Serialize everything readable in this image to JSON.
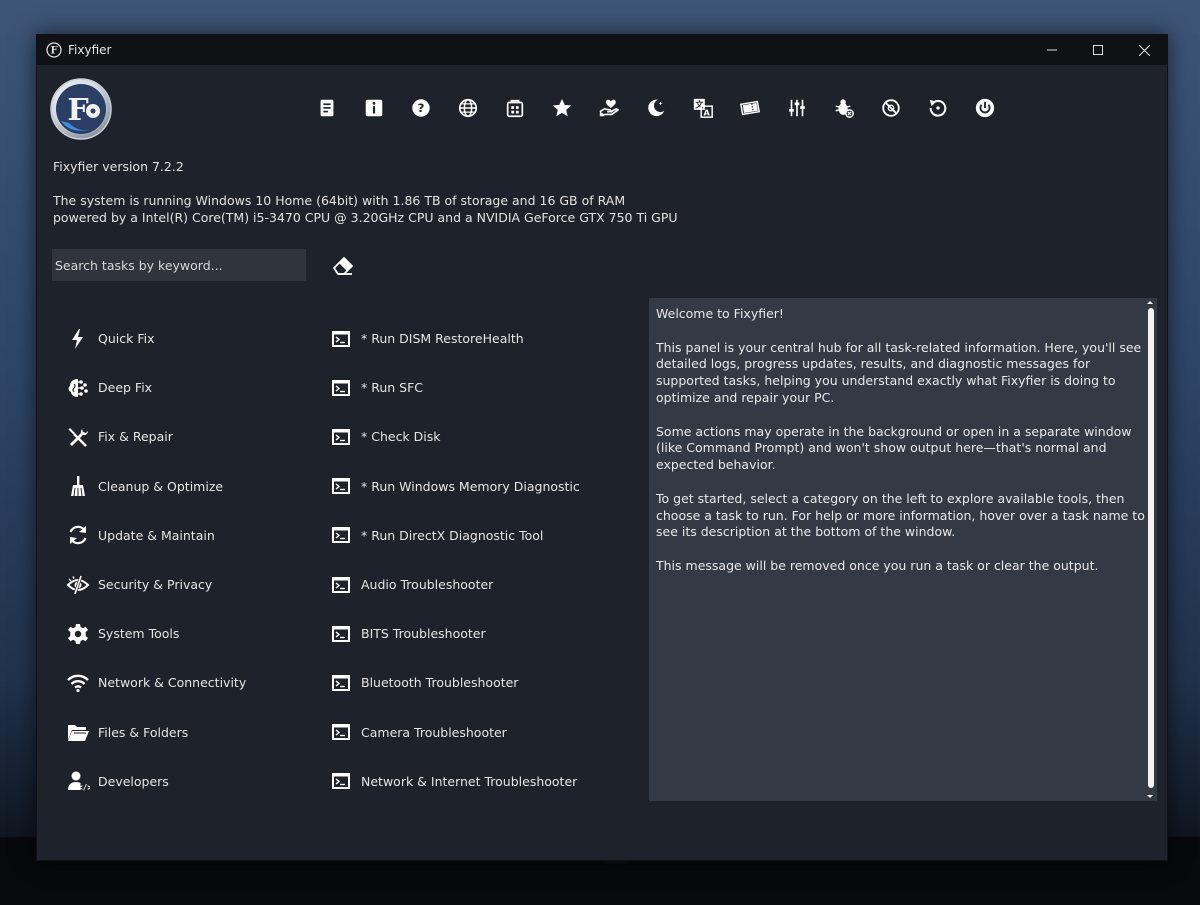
{
  "window": {
    "title": "Fixyfier",
    "version_label": "Fixyfier version 7.2.2",
    "sysinfo_line1": "The system is running Windows 10 Home (64bit) with 1.86 TB of storage and 16 GB of RAM",
    "sysinfo_line2": "powered by a Intel(R) Core(TM) i5-3470 CPU @ 3.20GHz CPU and a NVIDIA GeForce GTX 750 Ti GPU"
  },
  "toolbar": {
    "icons": [
      "notes-icon",
      "info-icon",
      "help-icon",
      "globe-icon",
      "store-icon",
      "star-icon",
      "heart-hand-icon",
      "moon-icon",
      "translate-icon",
      "ticket-icon",
      "sliders-icon",
      "bug-icon",
      "block-icon",
      "restore-icon",
      "power-icon"
    ]
  },
  "search": {
    "placeholder": "Search tasks by keyword..."
  },
  "categories": [
    {
      "label": "Quick Fix",
      "icon": "bolt-icon"
    },
    {
      "label": "Deep Fix",
      "icon": "brain-icon"
    },
    {
      "label": "Fix & Repair",
      "icon": "tools-icon"
    },
    {
      "label": "Cleanup & Optimize",
      "icon": "broom-icon"
    },
    {
      "label": "Update & Maintain",
      "icon": "refresh-icon"
    },
    {
      "label": "Security & Privacy",
      "icon": "eye-slash-icon"
    },
    {
      "label": "System Tools",
      "icon": "gear-icon"
    },
    {
      "label": "Network & Connectivity",
      "icon": "wifi-icon"
    },
    {
      "label": "Files & Folders",
      "icon": "folder-icon"
    },
    {
      "label": "Developers",
      "icon": "developer-icon"
    }
  ],
  "tasks": [
    "* Run DISM RestoreHealth",
    "* Run SFC",
    "* Check Disk",
    "* Run Windows Memory Diagnostic",
    "* Run DirectX Diagnostic Tool",
    "Audio Troubleshooter",
    "BITS Troubleshooter",
    "Bluetooth Troubleshooter",
    "Camera Troubleshooter",
    "Network & Internet Troubleshooter"
  ],
  "output": {
    "paragraphs": [
      "Welcome to Fixyfier!",
      "This panel is your central hub for all task-related information. Here, you'll see detailed logs, progress updates, results, and diagnostic messages for supported tasks, helping you understand exactly what Fixyfier is doing to optimize and repair your PC.",
      "Some actions may operate in the background or open in a separate window (like Command Prompt) and won't show output here—that's normal and expected behavior.",
      "To get started, select a category on the left to explore available tools, then choose a task to run. For help or more information, hover over a task name to see its description at the bottom of the window.",
      "This message will be removed once you run a task or clear the output."
    ]
  },
  "colors": {
    "window_bg": "#1e222a",
    "panel_bg": "#343a44",
    "input_bg": "#2f343d",
    "text": "#e6e6e6"
  }
}
